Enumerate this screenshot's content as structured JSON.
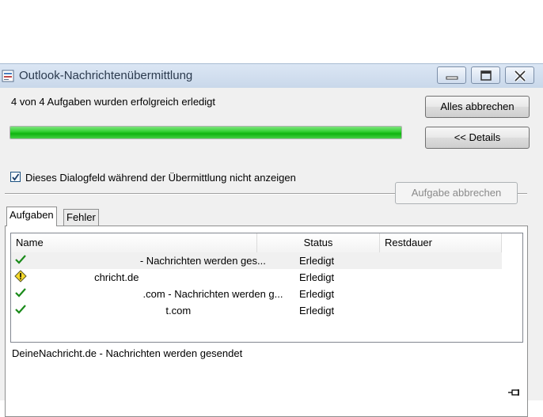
{
  "window": {
    "title": "Outlook-Nachrichtenübermittlung",
    "minimize_icon": "minimize-icon",
    "maximize_icon": "maximize-icon",
    "close_icon": "close-icon"
  },
  "status": {
    "message": "4 von 4 Aufgaben wurden erfolgreich erledigt",
    "progress": 1.0,
    "progress_color": "#22c022"
  },
  "buttons": {
    "cancel_all": "Alles abbrechen",
    "details": "<< Details",
    "cancel_task": "Aufgabe abbrechen"
  },
  "checkbox": {
    "label": "Dieses Dialogfeld während der Übermittlung nicht anzeigen",
    "checked": true
  },
  "tabs": [
    {
      "label": "Aufgaben",
      "active": true
    },
    {
      "label": "Fehler",
      "active": false
    }
  ],
  "table": {
    "columns": [
      "Name",
      "Status",
      "Restdauer"
    ],
    "rows": [
      {
        "icon": "green-check-icon",
        "name": "                                       - Nachrichten werden ges...",
        "status": "Erledigt",
        "remaining": ""
      },
      {
        "icon": "warning-icon",
        "name": "                       chricht.de",
        "status": "Erledigt",
        "remaining": ""
      },
      {
        "icon": "green-check-icon",
        "name": "                                        .com - Nachrichten werden g...",
        "status": "Erledigt",
        "remaining": ""
      },
      {
        "icon": "green-check-icon",
        "name": "                                                t.com",
        "status": "Erledigt",
        "remaining": ""
      }
    ]
  },
  "current_task": "DeineNachricht.de - Nachrichten werden gesendet",
  "pin_icon": "pin-icon"
}
